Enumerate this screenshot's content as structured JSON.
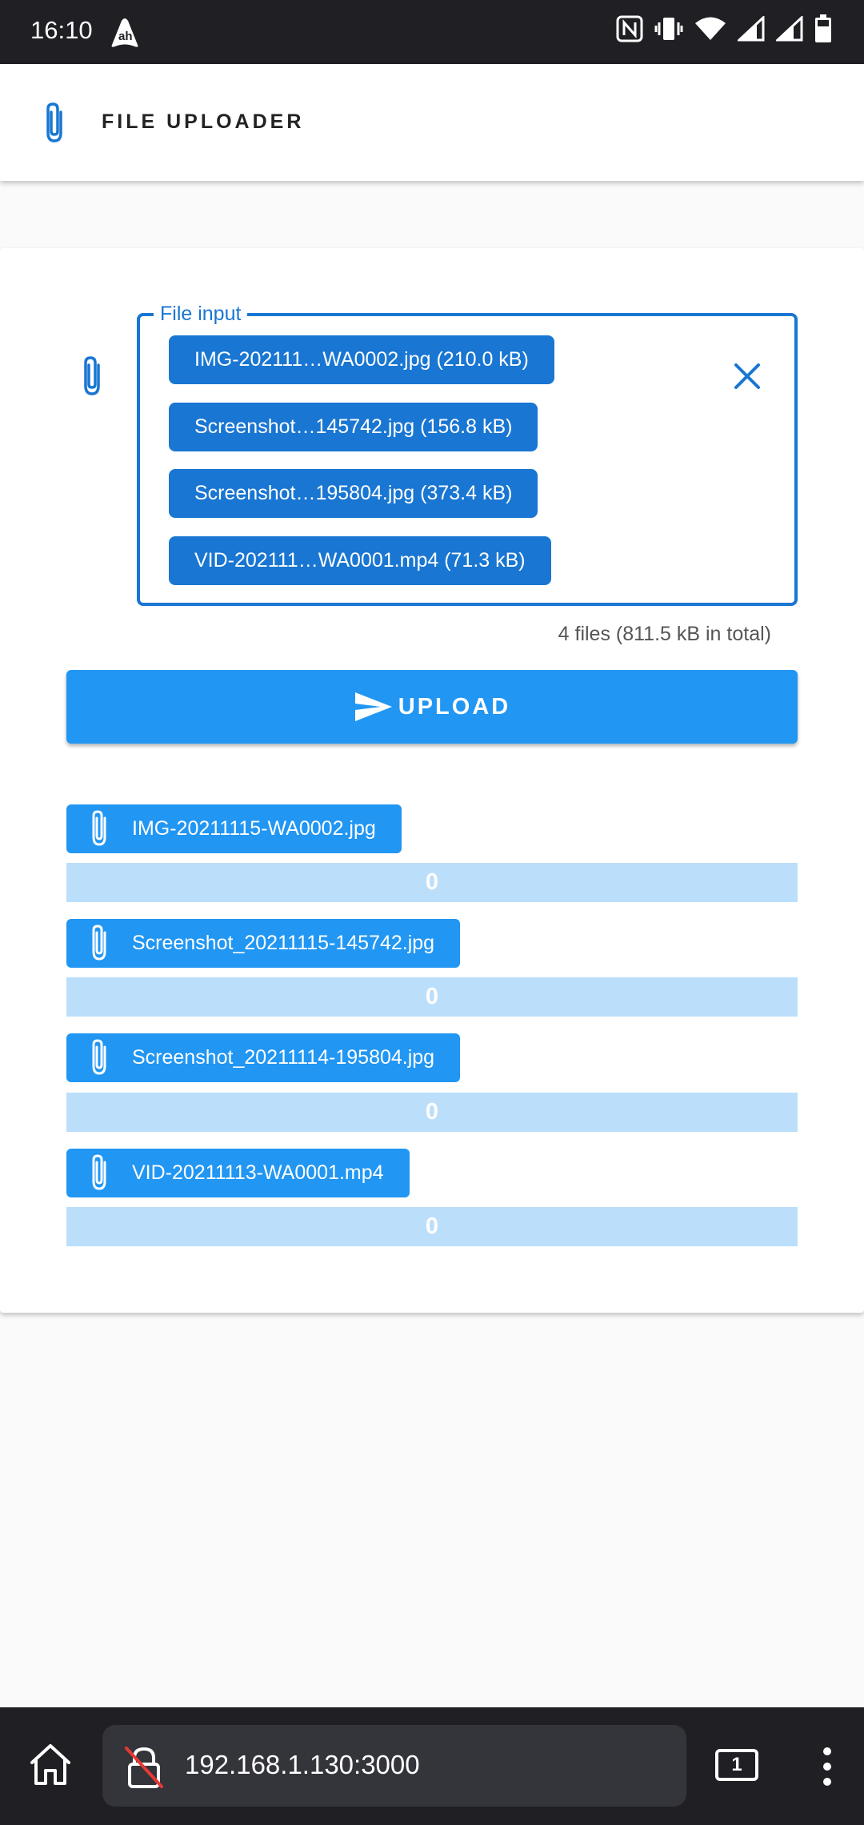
{
  "status_bar": {
    "time": "16:10"
  },
  "app": {
    "title": "FILE UPLOADER"
  },
  "file_input": {
    "label": "File input",
    "chips": [
      "IMG-202111…WA0002.jpg (210.0 kB)",
      "Screenshot…145742.jpg (156.8 kB)",
      "Screenshot…195804.jpg (373.4 kB)",
      "VID-202111…WA0001.mp4 (71.3 kB)"
    ],
    "summary": "4 files (811.5 kB in total)"
  },
  "upload_button": {
    "label": "UPLOAD"
  },
  "uploads": [
    {
      "name": "IMG-20211115-WA0002.jpg",
      "progress_text": "0",
      "progress_fraction": 0
    },
    {
      "name": "Screenshot_20211115-145742.jpg",
      "progress_text": "0",
      "progress_fraction": 0
    },
    {
      "name": "Screenshot_20211114-195804.jpg",
      "progress_text": "0",
      "progress_fraction": 0
    },
    {
      "name": "VID-20211113-WA0001.mp4",
      "progress_text": "0",
      "progress_fraction": 0
    }
  ],
  "browser": {
    "url": "192.168.1.130:3000",
    "tab_count": "1"
  },
  "colors": {
    "primary": "#1976d2",
    "accent": "#2196f3",
    "progress_track": "#bbdefb",
    "dark_bar": "#1f1f24"
  }
}
